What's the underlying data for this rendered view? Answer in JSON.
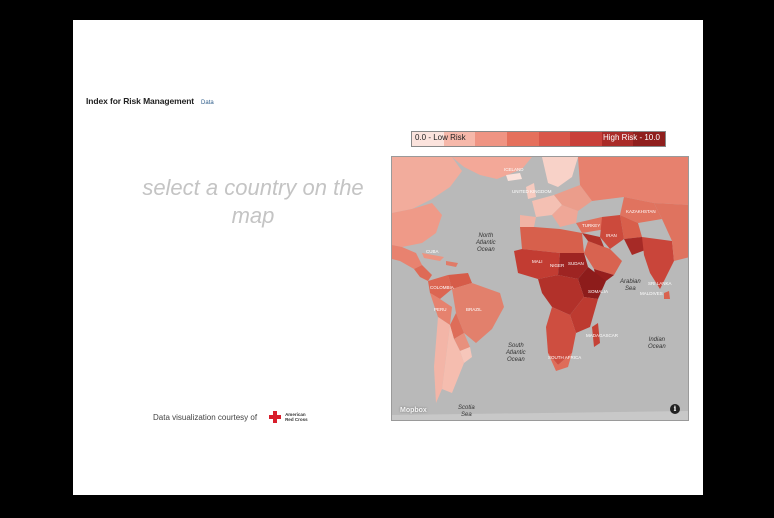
{
  "header": {
    "title": "Index for Risk Management",
    "data_link": "Data"
  },
  "prompt": {
    "line1": "select a country on the",
    "line2": "map"
  },
  "legend": {
    "low_label": "0.0 - Low Risk",
    "high_label": "High Risk - 10.0",
    "colors": [
      "#fbe3dd",
      "#f6b8aa",
      "#ef9483",
      "#e5705c",
      "#d9574a",
      "#c9403a",
      "#a92b28",
      "#8f1f1d"
    ]
  },
  "map": {
    "attribution": "Mopbox",
    "info_glyph": "i",
    "ocean_color": "#b9b9b9",
    "ocean_labels": [
      "North",
      "Atlantic",
      "Ocean",
      "South",
      "Atlantic",
      "Ocean",
      "Indian",
      "Ocean",
      "Arabian",
      "Sea",
      "Scotia",
      "Sea"
    ],
    "country_labels": [
      "ICELAND",
      "UNITED KINGDOM",
      "CUBA",
      "COLOMBIA",
      "BRAZIL",
      "PERU",
      "MALI",
      "NIGER",
      "SUDAN",
      "SOMALIA",
      "MADAGASCAR",
      "SOUTH AFRICA",
      "KAZAKHSTAN",
      "SRI LANKA",
      "MALDIVES",
      "TURKEY",
      "IRAN"
    ]
  },
  "credit": {
    "text": "Data visualization courtesy of",
    "logo_line1": "American",
    "logo_line2": "Red Cross"
  }
}
